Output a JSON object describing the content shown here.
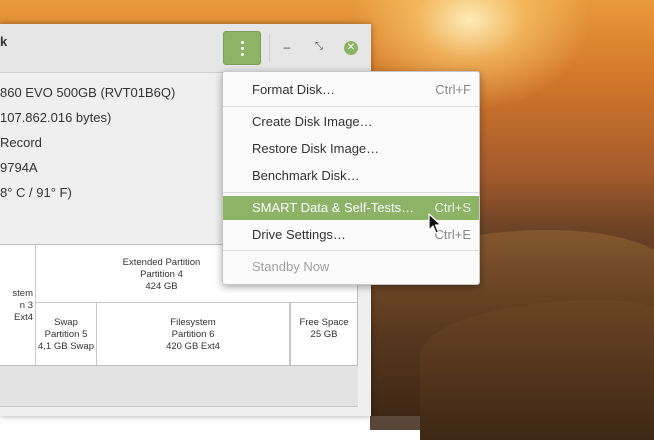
{
  "window": {
    "title": "k",
    "menu_button": "app-menu"
  },
  "disk_info": {
    "model": "860 EVO 500GB (RVT01B6Q)",
    "size": "107.862.016 bytes)",
    "partitioning": "Record",
    "serial": "9794A",
    "temperature": "8° C / 91° F)"
  },
  "partitions": {
    "extended": {
      "name": "Extended Partition",
      "partition": "Partition 4",
      "size": "424 GB"
    },
    "filesystem3": {
      "name": "stem",
      "partition": "n 3",
      "size": "Ext4"
    },
    "swap": {
      "name": "Swap",
      "partition": "Partition 5",
      "size": "4,1 GB Swap"
    },
    "filesystem6": {
      "name": "Filesystem",
      "partition": "Partition 6",
      "size": "420 GB Ext4"
    },
    "free": {
      "name": "Free Space",
      "size": "25 GB"
    }
  },
  "menu": {
    "items": [
      {
        "label": "Format Disk…",
        "shortcut": "Ctrl+F"
      },
      {
        "label": "Create Disk Image…",
        "shortcut": ""
      },
      {
        "label": "Restore Disk Image…",
        "shortcut": ""
      },
      {
        "label": "Benchmark Disk…",
        "shortcut": ""
      },
      {
        "label": "SMART Data & Self-Tests…",
        "shortcut": "Ctrl+S"
      },
      {
        "label": "Drive Settings…",
        "shortcut": "Ctrl+E"
      },
      {
        "label": "Standby Now",
        "shortcut": ""
      }
    ],
    "highlighted_index": 4
  },
  "colors": {
    "accent": "#8db367"
  }
}
